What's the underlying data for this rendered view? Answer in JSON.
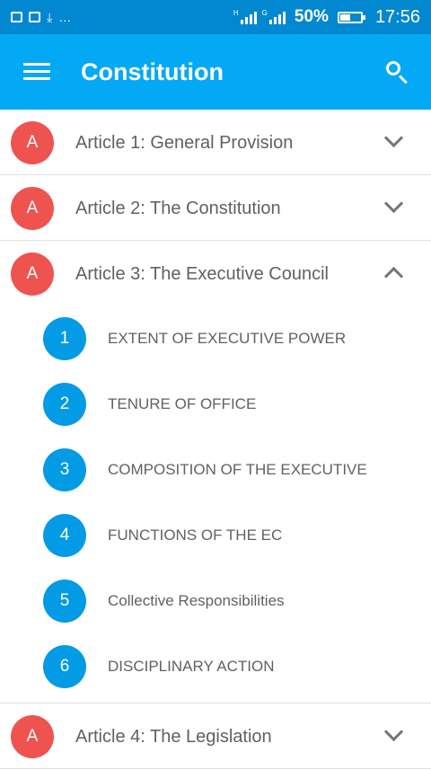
{
  "status_bar": {
    "signal_1_tag": "H",
    "signal_2_tag": "G",
    "battery_text": "50%",
    "time": "17:56",
    "battery_level_percent": 50
  },
  "app_bar": {
    "title": "Constitution",
    "menu_icon": "hamburger-menu-icon",
    "search_icon": "search-icon",
    "color": "#03a9f4"
  },
  "articles": [
    {
      "badge": "A",
      "title": "Article 1: General Provision",
      "expanded": false
    },
    {
      "badge": "A",
      "title": "Article 2: The Constitution",
      "expanded": false
    },
    {
      "badge": "A",
      "title": "Article 3: The Executive Council",
      "expanded": true,
      "sections": [
        {
          "num": "1",
          "title": "EXTENT OF EXECUTIVE POWER"
        },
        {
          "num": "2",
          "title": "TENURE OF OFFICE"
        },
        {
          "num": "3",
          "title": "COMPOSITION OF THE EXECUTIVE"
        },
        {
          "num": "4",
          "title": "FUNCTIONS OF THE EC"
        },
        {
          "num": "5",
          "title": "Collective Responsibilities"
        },
        {
          "num": "6",
          "title": "DISCIPLINARY ACTION"
        }
      ]
    },
    {
      "badge": "A",
      "title": "Article 4: The Legislation",
      "expanded": false
    }
  ],
  "colors": {
    "article_badge": "#ef5350",
    "section_badge": "#039be5"
  }
}
